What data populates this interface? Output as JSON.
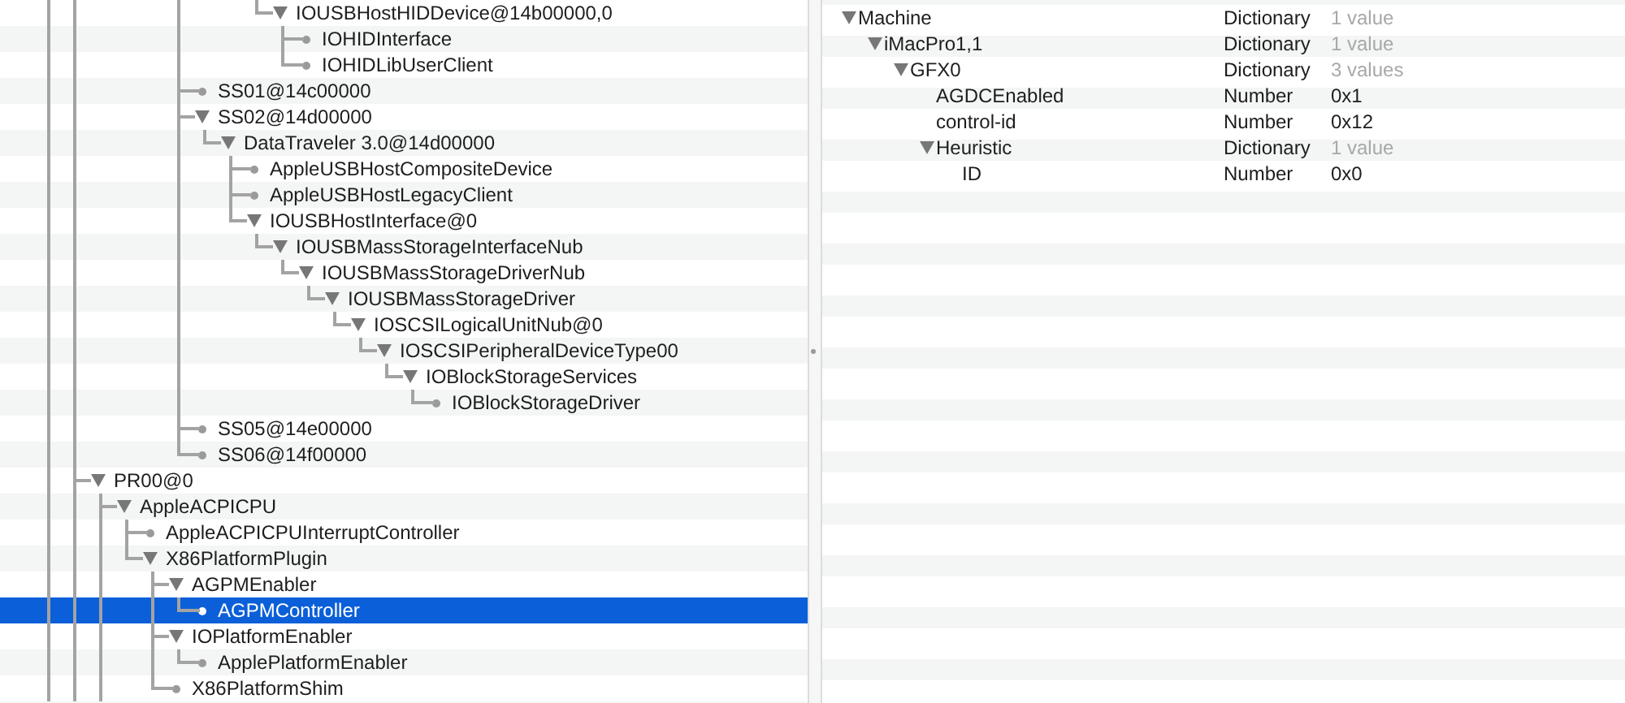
{
  "tree": [
    {
      "children": [
        {
          "children": [
            {
              "children": [
                {
                  "children": [
                    {
                      "children": [
                        {
                          "children": [
                            {
                              "children": [
                                {
                                  "label": "IOUSBHostHIDDevice@14b00000,0",
                                  "expanded": true,
                                  "selected": false,
                                  "children": [
                                    {
                                      "label": "IOHIDInterface",
                                      "selected": false
                                    },
                                    {
                                      "label": "IOHIDLibUserClient",
                                      "selected": false
                                    }
                                  ]
                                }
                              ]
                            }
                          ]
                        }
                      ]
                    },
                    {
                      "label": "SS01@14c00000",
                      "selected": false
                    },
                    {
                      "label": "SS02@14d00000",
                      "expanded": true,
                      "selected": false,
                      "children": [
                        {
                          "label": "DataTraveler 3.0@14d00000",
                          "expanded": true,
                          "selected": false,
                          "children": [
                            {
                              "label": "AppleUSBHostCompositeDevice",
                              "selected": false
                            },
                            {
                              "label": "AppleUSBHostLegacyClient",
                              "selected": false
                            },
                            {
                              "label": "IOUSBHostInterface@0",
                              "expanded": true,
                              "selected": false,
                              "children": [
                                {
                                  "label": "IOUSBMassStorageInterfaceNub",
                                  "expanded": true,
                                  "selected": false,
                                  "children": [
                                    {
                                      "label": "IOUSBMassStorageDriverNub",
                                      "expanded": true,
                                      "selected": false,
                                      "children": [
                                        {
                                          "label": "IOUSBMassStorageDriver",
                                          "expanded": true,
                                          "selected": false,
                                          "children": [
                                            {
                                              "label": "IOSCSILogicalUnitNub@0",
                                              "expanded": true,
                                              "selected": false,
                                              "children": [
                                                {
                                                  "label": "IOSCSIPeripheralDeviceType00",
                                                  "expanded": true,
                                                  "selected": false,
                                                  "children": [
                                                    {
                                                      "label": "IOBlockStorageServices",
                                                      "expanded": true,
                                                      "selected": false,
                                                      "children": [
                                                        {
                                                          "label": "IOBlockStorageDriver",
                                                          "selected": false
                                                        }
                                                      ]
                                                    }
                                                  ]
                                                }
                                              ]
                                            }
                                          ]
                                        }
                                      ]
                                    }
                                  ]
                                }
                              ]
                            }
                          ]
                        }
                      ]
                    },
                    {
                      "label": "SS05@14e00000",
                      "selected": false
                    },
                    {
                      "label": "SS06@14f00000",
                      "selected": false
                    }
                  ]
                }
              ]
            }
          ]
        }
      ]
    },
    {
      "label": "PR00@0",
      "expanded": true,
      "selected": false,
      "more_below": true,
      "children": [
        {
          "label": "AppleACPICPU",
          "expanded": true,
          "selected": false,
          "more_below": true,
          "children": [
            {
              "label": "AppleACPICPUInterruptController",
              "selected": false
            },
            {
              "label": "X86PlatformPlugin",
              "expanded": true,
              "selected": false,
              "children": [
                {
                  "label": "AGPMEnabler",
                  "expanded": true,
                  "selected": false,
                  "children": [
                    {
                      "label": "AGPMController",
                      "selected": true
                    }
                  ]
                },
                {
                  "label": "IOPlatformEnabler",
                  "expanded": true,
                  "selected": false,
                  "children": [
                    {
                      "label": "ApplePlatformEnabler",
                      "selected": false
                    }
                  ]
                },
                {
                  "label": "X86PlatformShim",
                  "selected": false
                }
              ]
            }
          ]
        }
      ]
    }
  ],
  "properties": [
    {
      "key": "Machine",
      "type": "Dictionary",
      "value": "1 value",
      "kind": "dictionary",
      "expanded": true,
      "children": [
        {
          "key": "iMacPro1,1",
          "type": "Dictionary",
          "value": "1 value",
          "kind": "dictionary",
          "expanded": true,
          "children": [
            {
              "key": "GFX0",
              "type": "Dictionary",
              "value": "3 values",
              "kind": "dictionary",
              "expanded": true,
              "children": [
                {
                  "key": "AGDCEnabled",
                  "type": "Number",
                  "value": "0x1",
                  "kind": "number"
                },
                {
                  "key": "control-id",
                  "type": "Number",
                  "value": "0x12",
                  "kind": "number"
                },
                {
                  "key": "Heuristic",
                  "type": "Dictionary",
                  "value": "1 value",
                  "kind": "dictionary",
                  "expanded": true,
                  "children": [
                    {
                      "key": "ID",
                      "type": "Number",
                      "value": "0x0",
                      "kind": "number"
                    }
                  ]
                }
              ]
            }
          ]
        }
      ]
    }
  ]
}
